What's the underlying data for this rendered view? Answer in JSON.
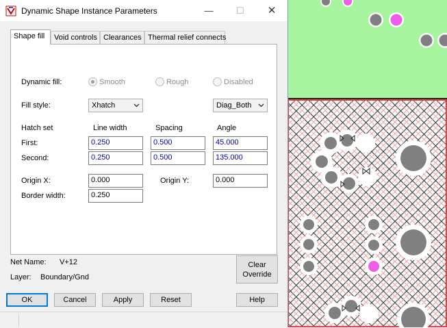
{
  "window": {
    "title": "Dynamic Shape Instance Parameters",
    "minimize": "—",
    "maximize": "☐",
    "close": "✕"
  },
  "tabs": [
    "Shape fill",
    "Void controls",
    "Clearances",
    "Thermal relief connects"
  ],
  "dynamic_fill": {
    "label": "Dynamic fill:",
    "options": [
      "Smooth",
      "Rough",
      "Disabled"
    ],
    "selected": "Smooth"
  },
  "fill_style": {
    "label": "Fill style:",
    "value": "Xhatch",
    "direction": "Diag_Both"
  },
  "hatch": {
    "header_label": "Hatch set",
    "col_line_width": "Line width",
    "col_spacing": "Spacing",
    "col_angle": "Angle",
    "first_label": "First:",
    "second_label": "Second:",
    "first": {
      "line_width": "0.250",
      "spacing": "0.500",
      "angle": "45.000"
    },
    "second": {
      "line_width": "0.250",
      "spacing": "0.500",
      "angle": "135.000"
    }
  },
  "origin": {
    "x_label": "Origin X:",
    "x": "0.000",
    "y_label": "Origin Y:",
    "y": "0.000"
  },
  "border": {
    "label": "Border width:",
    "value": "0.250"
  },
  "net": {
    "label": "Net Name:",
    "value": "V+12"
  },
  "layer": {
    "label": "Layer:",
    "value": "Boundary/Gnd"
  },
  "buttons": {
    "clear_override_1": "Clear",
    "clear_override_2": "Override",
    "ok": "OK",
    "cancel": "Cancel",
    "apply": "Apply",
    "reset": "Reset",
    "help": "Help"
  },
  "colors": {
    "board_green": "#a6f59e",
    "pad_gray": "#808080",
    "pad_pink": "#ee5ce8",
    "hatch_red": "#e84040",
    "hatch_dark": "#333333",
    "default_button_border": "#0078d7"
  }
}
